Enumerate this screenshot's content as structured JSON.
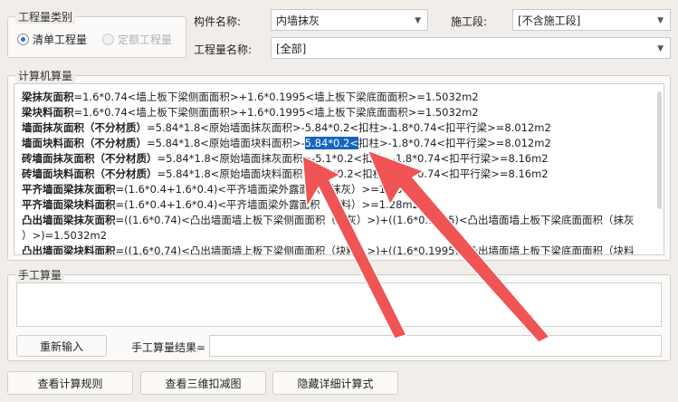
{
  "category": {
    "legend": "工程量类别",
    "options": [
      {
        "label": "清单工程量",
        "checked": true,
        "enabled": true
      },
      {
        "label": "定额工程量",
        "checked": false,
        "enabled": false
      }
    ]
  },
  "filters": {
    "component_label": "构件名称:",
    "component_value": "内墙抹灰",
    "stage_label": "施工段:",
    "stage_value": "[不含施工段]",
    "quantity_label": "工程量名称:",
    "quantity_value": "[全部]"
  },
  "calc": {
    "legend": "计算机算量",
    "lines": [
      {
        "name": "梁抹灰面积",
        "pre": "=1.6*0.74<墙上板下梁侧面面积>+1.6*0.1995<墙上板下梁底面面积>=1.5032m2",
        "hl": "",
        "post": ""
      },
      {
        "name": "梁块料面积",
        "pre": "=1.6*0.74<墙上板下梁侧面面积>+1.6*0.1995<墙上板下梁底面面积>=1.5032m2",
        "hl": "",
        "post": ""
      },
      {
        "name": "墙面抹灰面积（不分材质）",
        "pre": "=5.84*1.8<原始墙面抹灰面积>-5.84*0.2<扣柱>-1.8*0.74<扣平行梁>=8.012m2",
        "hl": "",
        "post": ""
      },
      {
        "name": "墙面块料面积（不分材质）",
        "pre": "=5.84*1.8<原始墙面块料面积>-",
        "hl": "5.84*0.2<",
        "post": "扣柱>-1.8*0.74<扣平行梁>=8.012m2"
      },
      {
        "name": "砖墙面抹灰面积（不分材质）",
        "pre": "=5.84*1.8<原始墙面抹灰面积>-5.1*0.2<扣柱>-1.8*0.74<扣平行梁>=8.16m2",
        "hl": "",
        "post": ""
      },
      {
        "name": "砖墙面块料面积（不分材质）",
        "pre": "=5.84*1.8<原始墙面块料面积>-5.1*0.2<扣柱>-1.8*0.74<扣平行梁>=8.16m2",
        "hl": "",
        "post": ""
      },
      {
        "name": "平齐墙面梁抹灰面积",
        "pre": "=(1.6*0.4+1.6*0.4)<平齐墙面梁外露面积（抹灰）>=1.28m2",
        "hl": "",
        "post": ""
      },
      {
        "name": "平齐墙面梁块料面积",
        "pre": "=(1.6*0.4+1.6*0.4)<平齐墙面梁外露面积（块料）>=1.28m2",
        "hl": "",
        "post": ""
      },
      {
        "name": "凸出墙面梁抹灰面积",
        "pre": "=((1.6*0.74)<凸出墙面墙上板下梁侧面面积（抹灰）>)+((1.6*0.1995)<凸出墙面墙上板下梁底面面积（抹灰",
        "hl": "",
        "post": ""
      },
      {
        "name": "",
        "pre": "）>)=1.5032m2",
        "hl": "",
        "post": ""
      },
      {
        "name": "凸出墙面梁块料面积",
        "pre": "=((1.6*0.74)<凸出墙面墙上板下梁侧面面积（块料）>)+((1.6*0.1995)<凸出墙面墙上板下梁底面面积（块料",
        "hl": "",
        "post": ""
      }
    ]
  },
  "manual": {
    "legend": "手工算量",
    "reenter": "重新输入",
    "result_label": "手工算量结果="
  },
  "buttons": {
    "rules": "查看计算规则",
    "view3d": "查看三维扣减图",
    "hide": "隐藏详细计算式"
  },
  "colors": {
    "highlight": "#1565c0",
    "arrow": "#f05454"
  }
}
